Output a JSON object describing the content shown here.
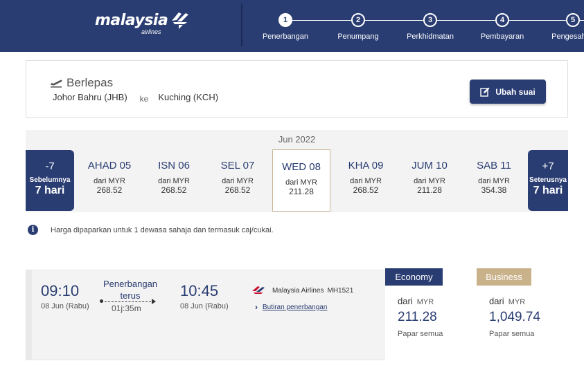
{
  "header": {
    "logo_text": "malaysia",
    "logo_sub": "airlines",
    "steps": [
      {
        "num": "1",
        "label": "Penerbangan",
        "active": true
      },
      {
        "num": "2",
        "label": "Penumpang",
        "active": false
      },
      {
        "num": "3",
        "label": "Perkhidmatan",
        "active": false
      },
      {
        "num": "4",
        "label": "Pembayaran",
        "active": false
      },
      {
        "num": "5",
        "label": "Pengesahan",
        "active": false
      }
    ]
  },
  "departure": {
    "title": "Berlepas",
    "origin": "Johor Bahru (JHB)",
    "connector": "ke",
    "destination": "Kuching (KCH)",
    "edit_label": "Ubah suai"
  },
  "dates": {
    "month": "Jun 2022",
    "prev": {
      "num": "-7",
      "label": "Sebelumnya",
      "days": "7 hari"
    },
    "next": {
      "num": "+7",
      "label": "Seterusnya",
      "days": "7 hari"
    },
    "from_label": "dari MYR",
    "items": [
      {
        "day": "AHAD 05",
        "price": "268.52",
        "selected": false
      },
      {
        "day": "ISN 06",
        "price": "268.52",
        "selected": false
      },
      {
        "day": "SEL 07",
        "price": "268.52",
        "selected": false
      },
      {
        "day": "WED 08",
        "price": "211.28",
        "selected": true
      },
      {
        "day": "KHA 09",
        "price": "268.52",
        "selected": false
      },
      {
        "day": "JUM 10",
        "price": "211.28",
        "selected": false
      },
      {
        "day": "SAB 11",
        "price": "354.38",
        "selected": false
      }
    ]
  },
  "info_text": "Harga dipaparkan untuk 1 dewasa sahaja dan termasuk caj/cukai.",
  "flight": {
    "dep_time": "09:10",
    "dep_date": "08 Jun (Rabu)",
    "type_line1": "Penerbangan",
    "type_line2": "terus",
    "duration": "01j:35m",
    "arr_time": "10:45",
    "arr_date": "08 Jun (Rabu)",
    "airline": "Malaysia Airlines",
    "flight_no": "MH1521",
    "details_link": "Butiran penerbangan",
    "fares": {
      "economy": {
        "label": "Economy",
        "from": "dari",
        "currency": "MYR",
        "price": "211.28",
        "show_all": "Papar semua"
      },
      "business": {
        "label": "Business",
        "from": "dari",
        "currency": "MYR",
        "price": "1,049.74",
        "show_all": "Papar semua"
      }
    }
  },
  "colors": {
    "brand_navy": "#2a3d72",
    "business_gold": "#c9b18a",
    "strip_bg": "#f3f3f3"
  }
}
